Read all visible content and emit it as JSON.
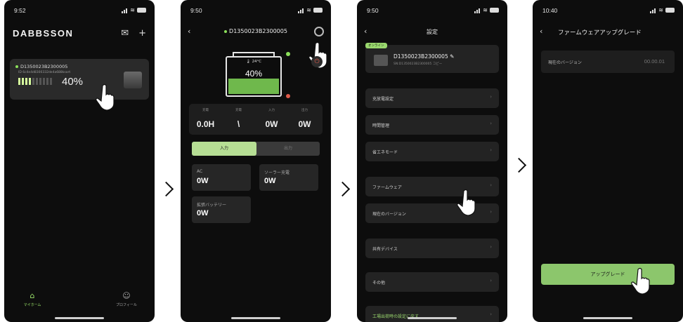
{
  "phone1": {
    "time": "9:52",
    "brand": "DABBSSON",
    "device": {
      "serial": "D1350023B2300005",
      "mac": "ID 6c4e4d8300332de4a688ksort",
      "percent": "40%",
      "segments_on": 4,
      "segments_total": 10
    },
    "tabs": {
      "home": "マイホーム",
      "profile": "プロフィール"
    }
  },
  "phone2": {
    "time": "9:50",
    "title": "D1350023B2300005",
    "temp": "24°C",
    "percent": "40%",
    "stats": [
      {
        "label": "充電",
        "value": "0.0H"
      },
      {
        "label": "充電",
        "value": "\\"
      },
      {
        "label": "入力",
        "value": "0W"
      },
      {
        "label": "出力",
        "value": "0W"
      }
    ],
    "segment": {
      "input": "入力",
      "output": "出力"
    },
    "cards": [
      {
        "label": "AC",
        "value": "0W"
      },
      {
        "label": "ソーラー充電",
        "value": "0W"
      },
      {
        "label": "拡張バッテリー",
        "value": "0W"
      }
    ]
  },
  "phone3": {
    "time": "9:50",
    "title": "設定",
    "online": "オンライン",
    "serial": "D1350023B2300005",
    "sub": "SN:D1350023B2300005 コピー",
    "menu": [
      "充放電設定",
      "時間管理",
      "省エネモード",
      "ファームウェア",
      "現在のバージョン",
      "共有デバイス",
      "その他",
      "工場出荷時の設定に戻す"
    ]
  },
  "phone4": {
    "time": "10:40",
    "title": "ファームウェアアップグレード",
    "version_label": "現在のバージョン",
    "version": "00.00.01",
    "upgrade": "アップグレード"
  },
  "colors": {
    "accent": "#8cc66c",
    "background": "#0d0d0d",
    "card": "#232323"
  }
}
